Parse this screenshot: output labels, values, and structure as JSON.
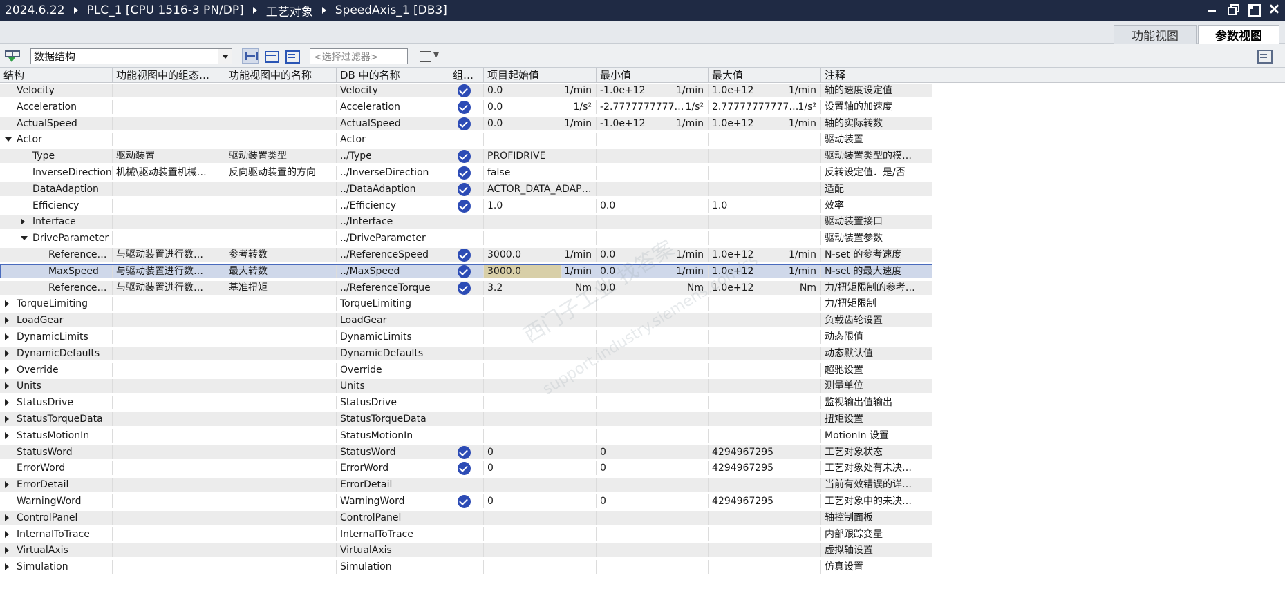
{
  "breadcrumb": [
    "2024.6.22",
    "PLC_1 [CPU 1516-3 PN/DP]",
    "工艺对象",
    "SpeedAxis_1 [DB3]"
  ],
  "tabs": {
    "function_view": "功能视图",
    "parameter_view": "参数视图"
  },
  "toolbar": {
    "dropdown_value": "数据结构",
    "filter_placeholder": "<选择过滤器>"
  },
  "columns": [
    "结构",
    "功能视图中的组态…",
    "功能视图中的名称",
    "DB 中的名称",
    "组…",
    "项目起始值",
    "最小值",
    "最大值",
    "注释"
  ],
  "watermark": {
    "line1": "西门子工业 找答案",
    "line2": "support.industry.siemens.com/cs"
  },
  "rows": [
    {
      "name": "Velocity",
      "indent": 0,
      "toggle": "",
      "config": "",
      "fname": "",
      "db": "Velocity",
      "check": true,
      "start": "0.0",
      "start_unit": "1/min",
      "min": "-1.0e+12",
      "min_unit": "1/min",
      "max": "1.0e+12",
      "max_unit": "1/min",
      "comment": "轴的速度设定值"
    },
    {
      "name": "Acceleration",
      "indent": 0,
      "toggle": "",
      "config": "",
      "fname": "",
      "db": "Acceleration",
      "check": true,
      "start": "0.0",
      "start_unit": "1/s²",
      "min": "-2.7777777777…",
      "min_unit": "1/s²",
      "max": "2.77777777777…",
      "max_unit": "1/s²",
      "comment": "设置轴的加速度"
    },
    {
      "name": "ActualSpeed",
      "indent": 0,
      "toggle": "",
      "config": "",
      "fname": "",
      "db": "ActualSpeed",
      "check": true,
      "start": "0.0",
      "start_unit": "1/min",
      "min": "-1.0e+12",
      "min_unit": "1/min",
      "max": "1.0e+12",
      "max_unit": "1/min",
      "comment": "轴的实际转数"
    },
    {
      "name": "Actor",
      "indent": 0,
      "toggle": "down",
      "config": "",
      "fname": "",
      "db": "Actor",
      "check": false,
      "start": "",
      "start_unit": "",
      "min": "",
      "min_unit": "",
      "max": "",
      "max_unit": "",
      "comment": "驱动装置"
    },
    {
      "name": "Type",
      "indent": 1,
      "toggle": "",
      "config": "驱动装置",
      "fname": "驱动装置类型",
      "db": "../Type",
      "check": true,
      "start": "PROFIDRIVE",
      "start_unit": "",
      "min": "",
      "min_unit": "",
      "max": "",
      "max_unit": "",
      "comment": "驱动装置类型的模…"
    },
    {
      "name": "InverseDirection",
      "indent": 1,
      "toggle": "",
      "config": "机械\\驱动装置机械…",
      "fname": "反向驱动装置的方向",
      "db": "../InverseDirection",
      "check": true,
      "start": "false",
      "start_unit": "",
      "min": "",
      "min_unit": "",
      "max": "",
      "max_unit": "",
      "comment": "反转设定值．是/否"
    },
    {
      "name": "DataAdaption",
      "indent": 1,
      "toggle": "",
      "config": "",
      "fname": "",
      "db": "../DataAdaption",
      "check": true,
      "start": "ACTOR_DATA_ADAP…",
      "start_unit": "",
      "min": "",
      "min_unit": "",
      "max": "",
      "max_unit": "",
      "comment": "适配"
    },
    {
      "name": "Efficiency",
      "indent": 1,
      "toggle": "",
      "config": "",
      "fname": "",
      "db": "../Efficiency",
      "check": true,
      "start": "1.0",
      "start_unit": "",
      "min": "0.0",
      "min_unit": "",
      "max": "1.0",
      "max_unit": "",
      "comment": "效率"
    },
    {
      "name": "Interface",
      "indent": 1,
      "toggle": "right",
      "config": "",
      "fname": "",
      "db": "../Interface",
      "check": false,
      "start": "",
      "start_unit": "",
      "min": "",
      "min_unit": "",
      "max": "",
      "max_unit": "",
      "comment": "驱动装置接口"
    },
    {
      "name": "DriveParameter",
      "indent": 1,
      "toggle": "down",
      "config": "",
      "fname": "",
      "db": "../DriveParameter",
      "check": false,
      "start": "",
      "start_unit": "",
      "min": "",
      "min_unit": "",
      "max": "",
      "max_unit": "",
      "comment": "驱动装置参数"
    },
    {
      "name": "ReferenceS…",
      "indent": 2,
      "toggle": "",
      "config": "与驱动装置进行数…",
      "fname": "参考转数",
      "db": "../ReferenceSpeed",
      "check": true,
      "start": "3000.0",
      "start_unit": "1/min",
      "min": "0.0",
      "min_unit": "1/min",
      "max": "1.0e+12",
      "max_unit": "1/min",
      "comment": "N-set 的参考速度"
    },
    {
      "name": "MaxSpeed",
      "indent": 2,
      "toggle": "",
      "config": "与驱动装置进行数…",
      "fname": "最大转数",
      "db": "../MaxSpeed",
      "check": true,
      "start": "3000.0",
      "start_unit": "1/min",
      "min": "0.0",
      "min_unit": "1/min",
      "max": "1.0e+12",
      "max_unit": "1/min",
      "comment": "N-set 的最大速度",
      "selected": true
    },
    {
      "name": "ReferenceT…",
      "indent": 2,
      "toggle": "",
      "config": "与驱动装置进行数…",
      "fname": "基准扭矩",
      "db": "../ReferenceTorque",
      "check": true,
      "start": "3.2",
      "start_unit": "Nm",
      "min": "0.0",
      "min_unit": "Nm",
      "max": "1.0e+12",
      "max_unit": "Nm",
      "comment": "力/扭矩限制的参考…"
    },
    {
      "name": "TorqueLimiting",
      "indent": 0,
      "toggle": "right",
      "config": "",
      "fname": "",
      "db": "TorqueLimiting",
      "check": false,
      "start": "",
      "start_unit": "",
      "min": "",
      "min_unit": "",
      "max": "",
      "max_unit": "",
      "comment": "力/扭矩限制"
    },
    {
      "name": "LoadGear",
      "indent": 0,
      "toggle": "right",
      "config": "",
      "fname": "",
      "db": "LoadGear",
      "check": false,
      "start": "",
      "start_unit": "",
      "min": "",
      "min_unit": "",
      "max": "",
      "max_unit": "",
      "comment": "负载齿轮设置"
    },
    {
      "name": "DynamicLimits",
      "indent": 0,
      "toggle": "right",
      "config": "",
      "fname": "",
      "db": "DynamicLimits",
      "check": false,
      "start": "",
      "start_unit": "",
      "min": "",
      "min_unit": "",
      "max": "",
      "max_unit": "",
      "comment": "动态限值"
    },
    {
      "name": "DynamicDefaults",
      "indent": 0,
      "toggle": "right",
      "config": "",
      "fname": "",
      "db": "DynamicDefaults",
      "check": false,
      "start": "",
      "start_unit": "",
      "min": "",
      "min_unit": "",
      "max": "",
      "max_unit": "",
      "comment": "动态默认值"
    },
    {
      "name": "Override",
      "indent": 0,
      "toggle": "right",
      "config": "",
      "fname": "",
      "db": "Override",
      "check": false,
      "start": "",
      "start_unit": "",
      "min": "",
      "min_unit": "",
      "max": "",
      "max_unit": "",
      "comment": "超驰设置"
    },
    {
      "name": "Units",
      "indent": 0,
      "toggle": "right",
      "config": "",
      "fname": "",
      "db": "Units",
      "check": false,
      "start": "",
      "start_unit": "",
      "min": "",
      "min_unit": "",
      "max": "",
      "max_unit": "",
      "comment": "测量单位"
    },
    {
      "name": "StatusDrive",
      "indent": 0,
      "toggle": "right",
      "config": "",
      "fname": "",
      "db": "StatusDrive",
      "check": false,
      "start": "",
      "start_unit": "",
      "min": "",
      "min_unit": "",
      "max": "",
      "max_unit": "",
      "comment": "监视输出值输出"
    },
    {
      "name": "StatusTorqueData",
      "indent": 0,
      "toggle": "right",
      "config": "",
      "fname": "",
      "db": "StatusTorqueData",
      "check": false,
      "start": "",
      "start_unit": "",
      "min": "",
      "min_unit": "",
      "max": "",
      "max_unit": "",
      "comment": "扭矩设置"
    },
    {
      "name": "StatusMotionIn",
      "indent": 0,
      "toggle": "right",
      "config": "",
      "fname": "",
      "db": "StatusMotionIn",
      "check": false,
      "start": "",
      "start_unit": "",
      "min": "",
      "min_unit": "",
      "max": "",
      "max_unit": "",
      "comment": "MotionIn 设置"
    },
    {
      "name": "StatusWord",
      "indent": 0,
      "toggle": "",
      "config": "",
      "fname": "",
      "db": "StatusWord",
      "check": true,
      "start": "0",
      "start_unit": "",
      "min": "0",
      "min_unit": "",
      "max": "4294967295",
      "max_unit": "",
      "comment": "工艺对象状态"
    },
    {
      "name": "ErrorWord",
      "indent": 0,
      "toggle": "",
      "config": "",
      "fname": "",
      "db": "ErrorWord",
      "check": true,
      "start": "0",
      "start_unit": "",
      "min": "0",
      "min_unit": "",
      "max": "4294967295",
      "max_unit": "",
      "comment": "工艺对象处有未决…"
    },
    {
      "name": "ErrorDetail",
      "indent": 0,
      "toggle": "right",
      "config": "",
      "fname": "",
      "db": "ErrorDetail",
      "check": false,
      "start": "",
      "start_unit": "",
      "min": "",
      "min_unit": "",
      "max": "",
      "max_unit": "",
      "comment": "当前有效错误的详…"
    },
    {
      "name": "WarningWord",
      "indent": 0,
      "toggle": "",
      "config": "",
      "fname": "",
      "db": "WarningWord",
      "check": true,
      "start": "0",
      "start_unit": "",
      "min": "0",
      "min_unit": "",
      "max": "4294967295",
      "max_unit": "",
      "comment": "工艺对象中的未决…"
    },
    {
      "name": "ControlPanel",
      "indent": 0,
      "toggle": "right",
      "config": "",
      "fname": "",
      "db": "ControlPanel",
      "check": false,
      "start": "",
      "start_unit": "",
      "min": "",
      "min_unit": "",
      "max": "",
      "max_unit": "",
      "comment": "轴控制面板"
    },
    {
      "name": "InternalToTrace",
      "indent": 0,
      "toggle": "right",
      "config": "",
      "fname": "",
      "db": "InternalToTrace",
      "check": false,
      "start": "",
      "start_unit": "",
      "min": "",
      "min_unit": "",
      "max": "",
      "max_unit": "",
      "comment": "内部跟踪变量"
    },
    {
      "name": "VirtualAxis",
      "indent": 0,
      "toggle": "right",
      "config": "",
      "fname": "",
      "db": "VirtualAxis",
      "check": false,
      "start": "",
      "start_unit": "",
      "min": "",
      "min_unit": "",
      "max": "",
      "max_unit": "",
      "comment": "虚拟轴设置"
    },
    {
      "name": "Simulation",
      "indent": 0,
      "toggle": "right",
      "config": "",
      "fname": "",
      "db": "Simulation",
      "check": false,
      "start": "",
      "start_unit": "",
      "min": "",
      "min_unit": "",
      "max": "",
      "max_unit": "",
      "comment": "仿真设置"
    }
  ]
}
